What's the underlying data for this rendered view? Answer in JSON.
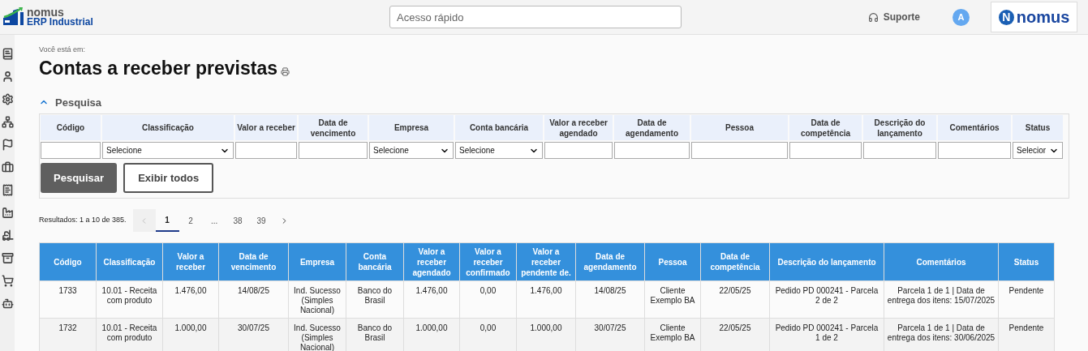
{
  "header": {
    "brand": "nomus",
    "product": "ERP Industrial",
    "quick_access": {
      "placeholder": "Acesso rápido"
    },
    "support": "Suporte",
    "avatar": "A",
    "logo_letter": "N",
    "logo_text": "nomus"
  },
  "sidebar": {
    "items": [
      {
        "kind": "book"
      },
      {
        "kind": "user"
      },
      {
        "kind": "gear"
      },
      {
        "kind": "hierarchy"
      },
      {
        "kind": "flag"
      },
      {
        "kind": "briefcase"
      },
      {
        "kind": "receipt"
      },
      {
        "kind": "factory"
      },
      {
        "kind": "forklift"
      },
      {
        "kind": "archive"
      },
      {
        "kind": "cart"
      },
      {
        "kind": "robot"
      }
    ]
  },
  "breadcrumb": "Você está em:",
  "title": "Contas a receber previstas",
  "search": {
    "title": "Pesquisa",
    "expanded": true,
    "fields": [
      {
        "label": "Código",
        "kind": "text"
      },
      {
        "label": "Classificação",
        "kind": "select",
        "value": "Selecione"
      },
      {
        "label": "Valor a receber",
        "kind": "text"
      },
      {
        "label": "Data de vencimento",
        "kind": "text"
      },
      {
        "label": "Empresa",
        "kind": "select",
        "value": "Selecione"
      },
      {
        "label": "Conta bancária",
        "kind": "select",
        "value": "Selecione"
      },
      {
        "label": "Valor a receber agendado",
        "kind": "text"
      },
      {
        "label": "Data de agendamento",
        "kind": "text"
      },
      {
        "label": "Pessoa",
        "kind": "text"
      },
      {
        "label": "Data de competência",
        "kind": "text"
      },
      {
        "label": "Descrição do lançamento",
        "kind": "text"
      },
      {
        "label": "Comentários",
        "kind": "text"
      },
      {
        "label": "Status",
        "kind": "select",
        "value": "Selecior"
      }
    ],
    "buttons": [
      {
        "label": "Pesquisar",
        "kind": "primary"
      },
      {
        "label": "Exibir todos",
        "kind": "secondary"
      }
    ]
  },
  "results": {
    "summary": "Resultados: 1 a 10 de 385.",
    "pages": [
      {
        "label": "1",
        "selected": true
      },
      {
        "label": "2",
        "selected": false
      },
      {
        "label": "...",
        "selected": false
      },
      {
        "label": "38",
        "selected": false
      },
      {
        "label": "39",
        "selected": false
      }
    ],
    "prev_disabled": true
  },
  "table": {
    "columns": [
      "Código",
      "Classificação",
      "Valor a receber",
      "Data de vencimento",
      "Empresa",
      "Conta bancária",
      "Valor a receber agendado",
      "Valor a receber confirmado",
      "Valor a receber pendente de.",
      "Data de agendamento",
      "Pessoa",
      "Data de competência",
      "Descrição do lançamento",
      "Comentários",
      "Status"
    ],
    "rows": [
      [
        "1733",
        "10.01 - Receita com produto",
        "1.476,00",
        "14/08/25",
        "Ind. Sucesso (Simples Nacional)",
        "Banco do Brasil",
        "1.476,00",
        "0,00",
        "1.476,00",
        "14/08/25",
        "Cliente Exemplo BA",
        "22/05/25",
        "Pedido PD 000241 - Parcela 2 de 2",
        "Parcela 1 de 1 | Data de entrega dos itens: 15/07/2025",
        "Pendente"
      ],
      [
        "1732",
        "10.01 - Receita com produto",
        "1.000,00",
        "30/07/25",
        "Ind. Sucesso (Simples Nacional)",
        "Banco do Brasil",
        "1.000,00",
        "0,00",
        "1.000,00",
        "30/07/25",
        "Cliente Exemplo BA",
        "22/05/25",
        "Pedido PD 000241 - Parcela 1 de 2",
        "Parcela 1 de 1 | Data de entrega dos itens: 30/06/2025",
        "Pendente"
      ]
    ]
  }
}
